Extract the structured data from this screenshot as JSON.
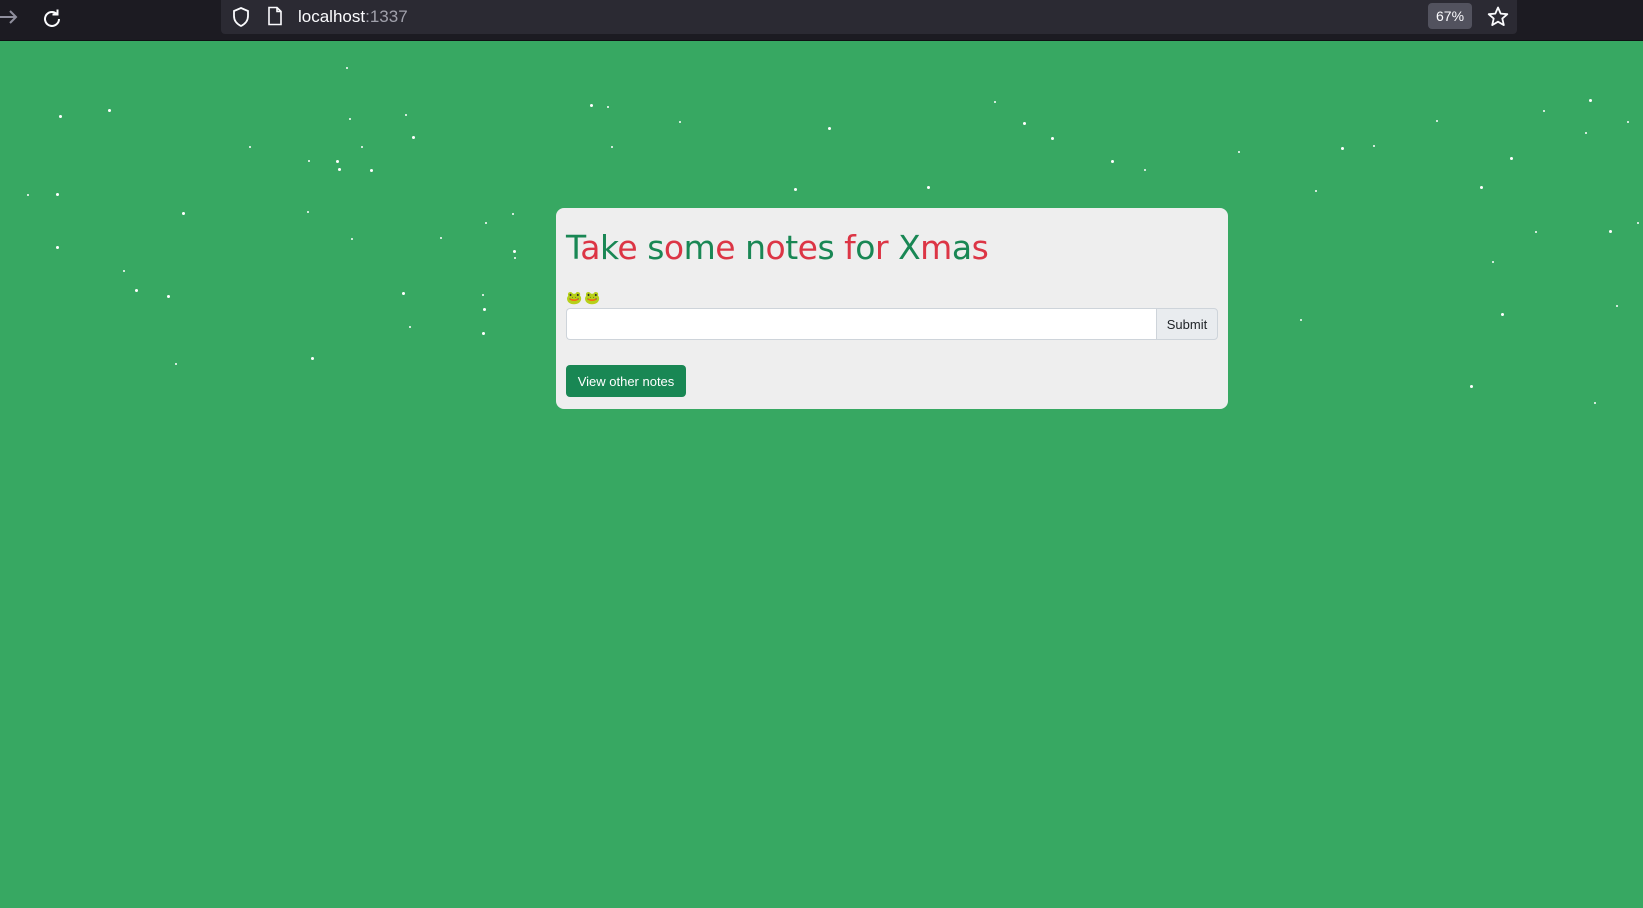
{
  "browser": {
    "url_host": "localhost",
    "url_port": ":1337",
    "zoom": "67%",
    "icons": [
      "forward-arrow-icon",
      "reload-icon",
      "shield-icon",
      "page-icon",
      "star-icon"
    ]
  },
  "page": {
    "background_color": "#37a862",
    "heading": {
      "text": "Take some notes for Xmas",
      "color_green": "#198754",
      "color_red": "#dc3545"
    },
    "frogs": "🐸🐸",
    "note_input": {
      "value": "",
      "placeholder": ""
    },
    "submit_label": "Submit",
    "view_notes_label": "View other notes"
  }
}
